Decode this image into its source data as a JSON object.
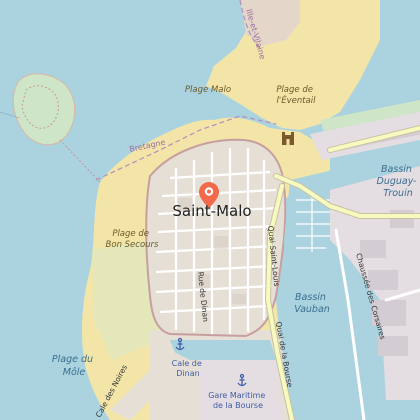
{
  "map": {
    "town": "Saint-Malo",
    "water_labels": [
      {
        "id": "bassin-duguay",
        "lines": [
          "Bassin",
          "Duguay-",
          "Trouin"
        ]
      },
      {
        "id": "bassin-vauban",
        "lines": [
          "Bassin",
          "Vauban"
        ]
      }
    ],
    "beach_labels": [
      {
        "id": "plage-malo",
        "lines": [
          "Plage Malo"
        ]
      },
      {
        "id": "plage-eventail",
        "lines": [
          "Plage de",
          "l'Éventail"
        ]
      },
      {
        "id": "plage-bon-secours",
        "lines": [
          "Plage de",
          "Bon Secours"
        ]
      },
      {
        "id": "plage-mole",
        "lines": [
          "Plage du",
          "Môle"
        ]
      }
    ],
    "road_labels": [
      {
        "id": "quai-saint-louis",
        "text": "Quai Saint-Louis"
      },
      {
        "id": "quai-bourse",
        "text": "Quai de la Bourse"
      },
      {
        "id": "chaussee-corsaires",
        "text": "Chaussée des Corsaires"
      },
      {
        "id": "rue-dinan",
        "text": "Rue de Dinan"
      },
      {
        "id": "cale-noires",
        "text": "Cale des Noires"
      },
      {
        "id": "bretagne",
        "text": "Bretagne"
      },
      {
        "id": "ille-vilaine",
        "text": "Ille-et-Vilaine"
      }
    ],
    "poi_labels": [
      {
        "id": "cale-dinan",
        "lines": [
          "Cale de",
          "Dinan"
        ]
      },
      {
        "id": "gare-maritime",
        "lines": [
          "Gare Maritime",
          "de la Bourse"
        ]
      }
    ],
    "colors": {
      "water": "#aad3df",
      "beach": "#f3e5a8",
      "land": "#e6dfd6",
      "marker": "#f26a4b",
      "road_major": "#f7fabf",
      "border": "#b08fba"
    },
    "icons": [
      "location-marker-icon",
      "castle-icon",
      "anchor-icon"
    ]
  }
}
